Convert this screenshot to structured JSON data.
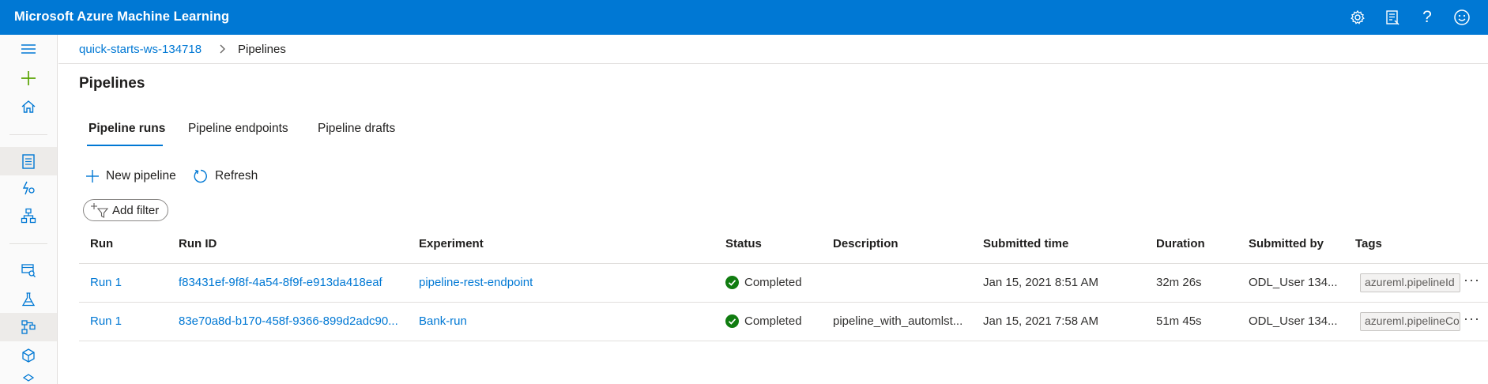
{
  "app": {
    "title": "Microsoft Azure Machine Learning",
    "brand_color": "#0078d4"
  },
  "topbar_icons": [
    "gear-icon",
    "feedback-list-icon",
    "help-icon",
    "smiley-icon"
  ],
  "topbar_glyphs": {
    "help": "?"
  },
  "rail_icons": [
    "hamburger-icon",
    "plus-icon",
    "home-icon",
    "notebook-icon",
    "automl-icon",
    "designer-icon",
    "datasets-icon",
    "experiments-icon",
    "pipelines-icon",
    "models-icon",
    "endpoints-icon"
  ],
  "breadcrumb": {
    "workspace": "quick-starts-ws-134718",
    "current": "Pipelines"
  },
  "page_title": "Pipelines",
  "tabs": [
    {
      "label": "Pipeline runs",
      "active": true
    },
    {
      "label": "Pipeline endpoints",
      "active": false
    },
    {
      "label": "Pipeline drafts",
      "active": false
    }
  ],
  "commands": {
    "new_pipeline": "New pipeline",
    "refresh": "Refresh",
    "add_filter": "Add filter"
  },
  "table": {
    "columns": [
      "Run",
      "Run ID",
      "Experiment",
      "Status",
      "Description",
      "Submitted time",
      "Duration",
      "Submitted by",
      "Tags"
    ],
    "rows": [
      {
        "run": "Run 1",
        "run_id": "f83431ef-9f8f-4a54-8f9f-e913da418eaf",
        "experiment": "pipeline-rest-endpoint",
        "status": "Completed",
        "description": "",
        "submitted_time": "Jan 15, 2021 8:51 AM",
        "duration": "32m 26s",
        "submitted_by": "ODL_User 134...",
        "tag": "azureml.pipelineId",
        "more": "···"
      },
      {
        "run": "Run 1",
        "run_id": "83e70a8d-b170-458f-9366-899d2adc90...",
        "experiment": "Bank-run",
        "status": "Completed",
        "description": "pipeline_with_automlst...",
        "submitted_time": "Jan 15, 2021 7:58 AM",
        "duration": "51m 45s",
        "submitted_by": "ODL_User 134...",
        "tag": "azureml.pipelineComponent",
        "more": "···"
      }
    ]
  },
  "status_color": "#107c10"
}
